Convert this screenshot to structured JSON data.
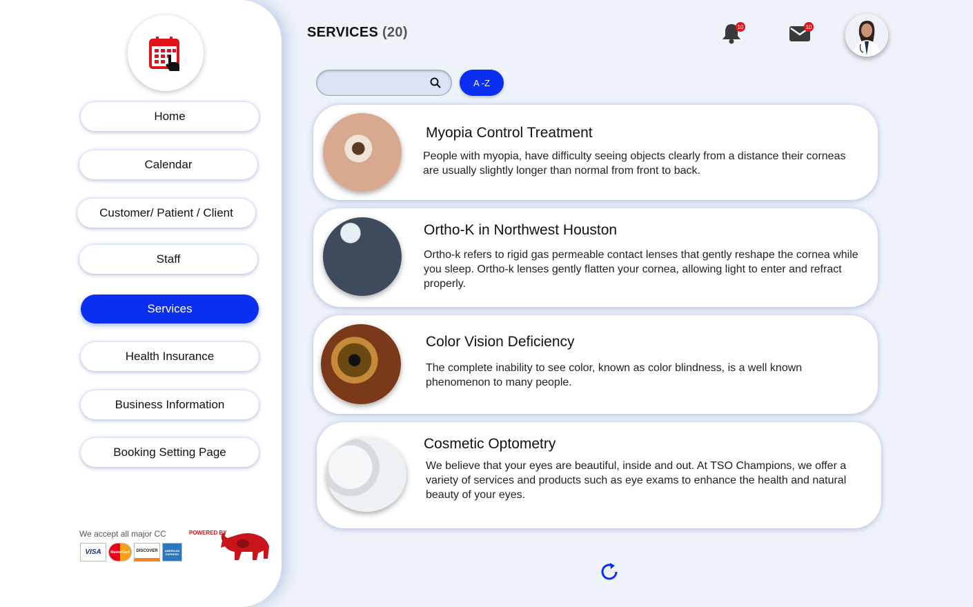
{
  "sidebar": {
    "logo_icon": "calendar-click-icon",
    "items": [
      {
        "label": "Home",
        "active": false
      },
      {
        "label": "Calendar",
        "active": false
      },
      {
        "label": "Customer/ Patient / Client",
        "active": false
      },
      {
        "label": "Staff",
        "active": false
      },
      {
        "label": "Services",
        "active": true
      },
      {
        "label": "Health Insurance",
        "active": false
      },
      {
        "label": "Business Information",
        "active": false
      },
      {
        "label": "Booking Setting Page",
        "active": false
      }
    ],
    "cc_text": "We accept all major CC",
    "cards": [
      "VISA",
      "MasterCard",
      "DISCOVER",
      "AMERICAN EXPRESS"
    ],
    "powered_by": "POWERED BY"
  },
  "header": {
    "title": "SERVICES",
    "count": "(20)",
    "notifications_badge": "10",
    "messages_badge": "10"
  },
  "search": {
    "placeholder": "",
    "value": "",
    "sort_label": "A -Z"
  },
  "services": [
    {
      "title": "Myopia Control Treatment",
      "description": "People with myopia, have difficulty seeing objects clearly from a distance their corneas are usually slightly longer than normal from front to back."
    },
    {
      "title": "Ortho-K in Northwest Houston",
      "description": "Ortho-k refers to rigid gas permeable contact lenses that gently reshape the cornea while you sleep. Ortho-k lenses gently flatten your cornea, allowing light to enter and refract properly."
    },
    {
      "title": "Color Vision Deficiency",
      "description": "The complete inability to see color, known as color blindness, is a well known phenomenon to many people."
    },
    {
      "title": "Cosmetic Optometry",
      "description": "We believe that your eyes are beautiful, inside and out. At TSO Champions, we offer a variety of services and products such as eye exams to enhance the health and natural beauty of your eyes."
    }
  ],
  "colors": {
    "accent": "#0a2ff0",
    "badge": "#e0121a",
    "logo_red": "#d4141c"
  }
}
